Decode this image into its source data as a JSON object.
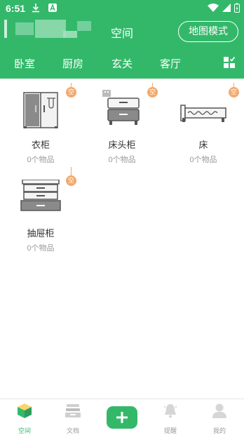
{
  "status_bar": {
    "time": "6:51"
  },
  "header": {
    "title": "空间",
    "map_mode_label": "地图模式"
  },
  "tabs": [
    {
      "label": "卧室"
    },
    {
      "label": "厨房"
    },
    {
      "label": "玄关"
    },
    {
      "label": "客厅"
    }
  ],
  "items": [
    {
      "name": "衣柜",
      "count": "0个物品",
      "tag": "空",
      "icon": "wardrobe-icon"
    },
    {
      "name": "床头柜",
      "count": "0个物品",
      "tag": "空",
      "icon": "nightstand-icon"
    },
    {
      "name": "床",
      "count": "0个物品",
      "tag": "空",
      "icon": "bed-icon"
    },
    {
      "name": "抽屉柜",
      "count": "0个物品",
      "tag": "空",
      "icon": "drawer-cabinet-icon"
    }
  ],
  "bottom_nav": [
    {
      "label": "空间",
      "icon": "box-icon",
      "active": true
    },
    {
      "label": "文档",
      "icon": "tray-icon",
      "active": false
    },
    {
      "label": "",
      "icon": "plus-icon",
      "active": false
    },
    {
      "label": "提醒",
      "icon": "bell-icon",
      "active": false
    },
    {
      "label": "我的",
      "icon": "user-icon",
      "active": false
    }
  ],
  "colors": {
    "primary": "#33b86a",
    "tag": "#f3a86a",
    "text": "#333333",
    "muted": "#999999"
  }
}
